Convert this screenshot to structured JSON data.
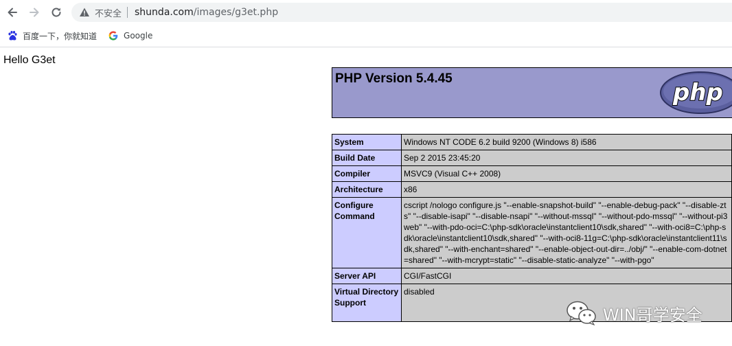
{
  "browser": {
    "security_label": "不安全",
    "url_host": "shunda.com",
    "url_path": "/images/g3et.php",
    "bookmarks": [
      {
        "label": "百度一下，你就知道",
        "icon": "baidu-paw-icon"
      },
      {
        "label": "Google",
        "icon": "google-g-icon"
      }
    ]
  },
  "page": {
    "hello": "Hello G3et",
    "php_title": "PHP Version 5.4.45",
    "logo_text": "php",
    "rows": [
      {
        "key": "System",
        "value": "Windows NT CODE 6.2 build 9200 (Windows 8) i586"
      },
      {
        "key": "Build Date",
        "value": "Sep 2 2015 23:45:20"
      },
      {
        "key": "Compiler",
        "value": "MSVC9 (Visual C++ 2008)"
      },
      {
        "key": "Architecture",
        "value": "x86"
      },
      {
        "key": "Configure Command",
        "value": "cscript /nologo configure.js \"--enable-snapshot-build\" \"--enable-debug-pack\" \"--disable-zts\" \"--disable-isapi\" \"--disable-nsapi\" \"--without-mssql\" \"--without-pdo-mssql\" \"--without-pi3web\" \"--with-pdo-oci=C:\\php-sdk\\oracle\\instantclient10\\sdk,shared\" \"--with-oci8=C:\\php-sdk\\oracle\\instantclient10\\sdk,shared\" \"--with-oci8-11g=C:\\php-sdk\\oracle\\instantclient11\\sdk,shared\" \"--with-enchant=shared\" \"--enable-object-out-dir=../obj/\" \"--enable-com-dotnet=shared\" \"--with-mcrypt=static\" \"--disable-static-analyze\" \"--with-pgo\""
      },
      {
        "key": "Server API",
        "value": "CGI/FastCGI"
      },
      {
        "key": "Virtual Directory Support",
        "value": "disabled"
      }
    ]
  },
  "watermark": {
    "text": "WIN哥学安全",
    "icon": "wechat-icon"
  }
}
